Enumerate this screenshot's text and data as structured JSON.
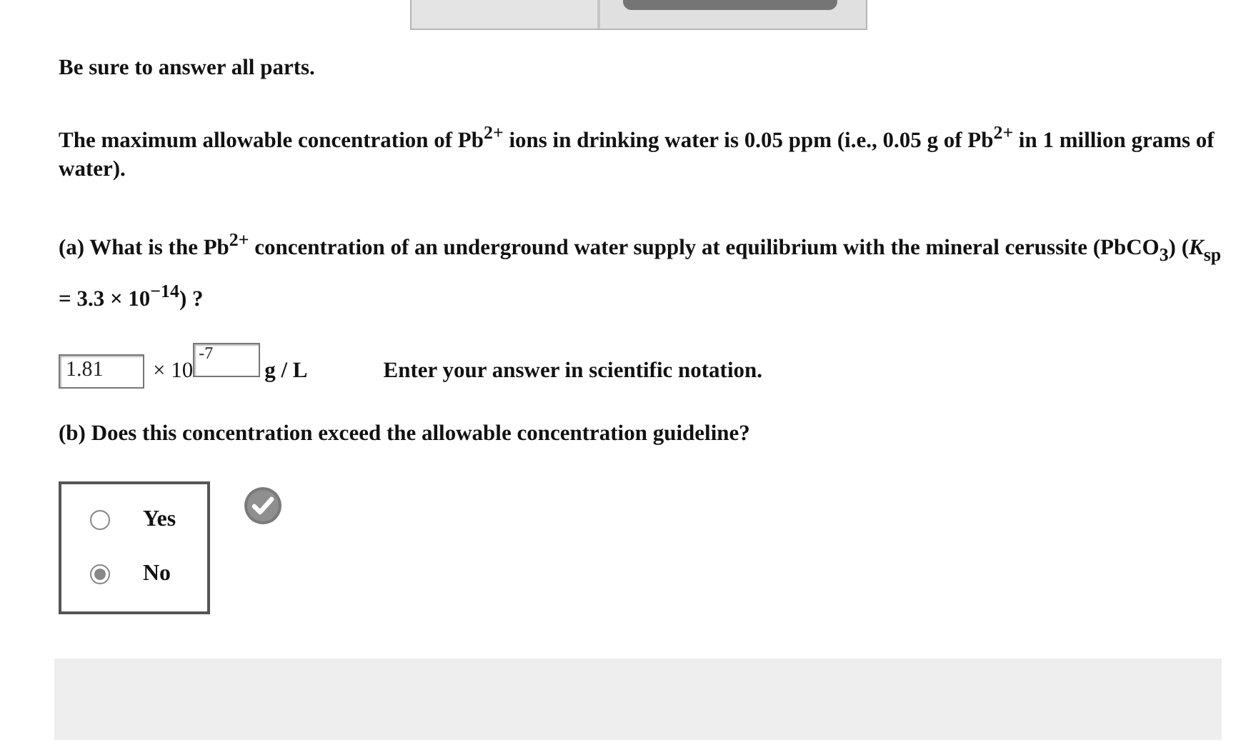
{
  "instructions": "Be sure to answer all parts.",
  "intro": "The maximum allowable concentration of Pb$^{2+}$ ions in drinking water is 0.05 ppm (i.e., 0.05 g of Pb$^{2+}$ in 1 million grams of water).",
  "part_a": {
    "question": "(a) What is the Pb$^{2+}$ concentration of an underground water supply at equilibrium with the mineral cerussite (PbCO$_{3}$) (*K*$_{sp}$ = 3.3 × 10$^{−14}$) ?",
    "answer": {
      "mantissa": "1.81",
      "times": "× 10",
      "exponent": "-7",
      "unit": "g / L",
      "hint": "Enter your answer in scientific notation."
    }
  },
  "part_b": {
    "question": "(b) Does this concentration exceed the allowable concentration guideline?",
    "options": [
      {
        "label": "Yes",
        "selected": false
      },
      {
        "label": "No",
        "selected": true
      }
    ],
    "graded_correct": true
  }
}
